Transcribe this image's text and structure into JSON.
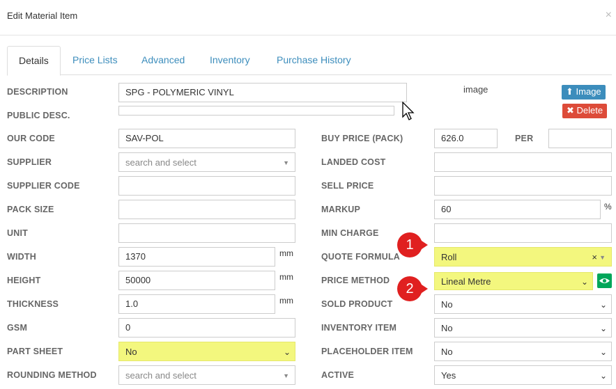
{
  "modal": {
    "title": "Edit Material Item",
    "close": "×"
  },
  "tabs": [
    "Details",
    "Price Lists",
    "Advanced",
    "Inventory",
    "Purchase History"
  ],
  "image": {
    "alt": "image",
    "upload_label": "Image",
    "delete_label": "Delete"
  },
  "left": {
    "description": {
      "label": "DESCRIPTION",
      "value": "SPG - POLYMERIC VINYL"
    },
    "public_desc": {
      "label": "PUBLIC DESC.",
      "value": ""
    },
    "our_code": {
      "label": "OUR CODE",
      "value": "SAV-POL"
    },
    "supplier": {
      "label": "SUPPLIER",
      "placeholder": "search and select"
    },
    "supplier_code": {
      "label": "SUPPLIER CODE",
      "value": ""
    },
    "pack_size": {
      "label": "PACK SIZE",
      "value": ""
    },
    "unit": {
      "label": "UNIT",
      "value": ""
    },
    "width": {
      "label": "WIDTH",
      "value": "1370",
      "unit": "mm"
    },
    "height": {
      "label": "HEIGHT",
      "value": "50000",
      "unit": "mm"
    },
    "thickness": {
      "label": "THICKNESS",
      "value": "1.0",
      "unit": "mm"
    },
    "gsm": {
      "label": "GSM",
      "value": "0"
    },
    "part_sheet": {
      "label": "PART SHEET",
      "value": "No"
    },
    "rounding_method": {
      "label": "ROUNDING METHOD",
      "placeholder": "search and select"
    }
  },
  "right": {
    "buy_price": {
      "label": "BUY PRICE (PACK)",
      "value": "626.0"
    },
    "per": {
      "label": "PER",
      "value": ""
    },
    "landed_cost": {
      "label": "LANDED COST",
      "value": ""
    },
    "sell_price": {
      "label": "SELL PRICE",
      "value": ""
    },
    "markup": {
      "label": "MARKUP",
      "value": "60",
      "unit": "%"
    },
    "min_charge": {
      "label": "MIN CHARGE",
      "value": ""
    },
    "quote_formula": {
      "label": "QUOTE FORMULA",
      "value": "Roll",
      "clear": "×"
    },
    "price_method": {
      "label": "PRICE METHOD",
      "value": "Lineal Metre"
    },
    "sold_product": {
      "label": "SOLD PRODUCT",
      "value": "No"
    },
    "inventory_item": {
      "label": "INVENTORY ITEM",
      "value": "No"
    },
    "placeholder_item": {
      "label": "PLACEHOLDER ITEM",
      "value": "No"
    },
    "active": {
      "label": "ACTIVE",
      "value": "Yes"
    }
  },
  "annotations": [
    "1",
    "2"
  ],
  "colors": {
    "link": "#3c8dbc",
    "highlight": "#f3f77e",
    "badge": "#e02020",
    "delete": "#dd4b39",
    "eye": "#00a65a"
  }
}
